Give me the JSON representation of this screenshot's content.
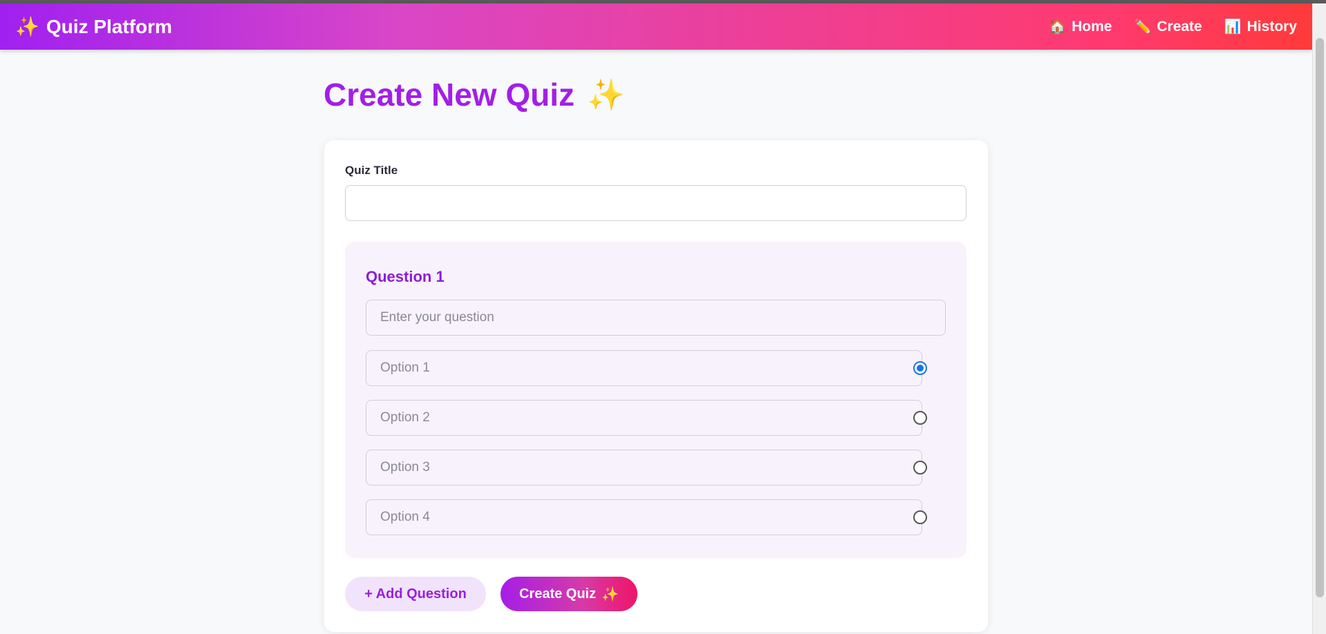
{
  "navbar": {
    "brand_icon": "✨",
    "brand": "Quiz Platform",
    "links": [
      {
        "icon": "🏠",
        "label": "Home"
      },
      {
        "icon": "✏️",
        "label": "Create"
      },
      {
        "icon": "📊",
        "label": "History"
      }
    ]
  },
  "page": {
    "title": "Create New Quiz",
    "title_icon": "✨"
  },
  "form": {
    "quiz_title_label": "Quiz Title",
    "quiz_title_value": "",
    "question": {
      "heading": "Question 1",
      "placeholder": "Enter your question",
      "options": [
        {
          "placeholder": "Option 1",
          "correct": true
        },
        {
          "placeholder": "Option 2",
          "correct": false
        },
        {
          "placeholder": "Option 3",
          "correct": false
        },
        {
          "placeholder": "Option 4",
          "correct": false
        }
      ]
    },
    "add_question_label": "+ Add Question",
    "create_quiz_label": "Create Quiz",
    "create_quiz_icon": "✨"
  },
  "colors": {
    "accent": "#a21fe6",
    "radio_selected": "#1a73e8"
  }
}
